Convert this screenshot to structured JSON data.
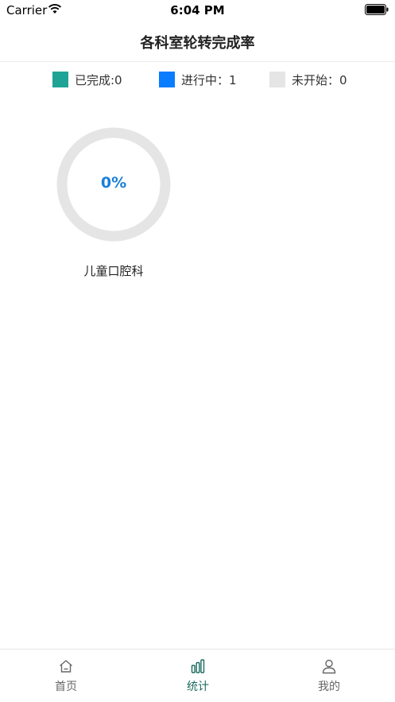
{
  "status_bar": {
    "carrier": "Carrier",
    "time": "6:04 PM"
  },
  "header": {
    "title": "各科室轮转完成率"
  },
  "legend": [
    {
      "label": "已完成:0",
      "color": "#1fa396"
    },
    {
      "label": "进行中：1",
      "color": "#0a7cff"
    },
    {
      "label": "未开始：0",
      "color": "#e5e5e5"
    }
  ],
  "departments": [
    {
      "name": "儿童口腔科",
      "percent_label": "0%",
      "completion": 0,
      "ring_color": "#e5e5e5",
      "progress_color": "#1a7fd8"
    }
  ],
  "tabs": [
    {
      "label": "首页",
      "icon": "home-icon",
      "active": false
    },
    {
      "label": "统计",
      "icon": "stats-icon",
      "active": true
    },
    {
      "label": "我的",
      "icon": "user-icon",
      "active": false
    }
  ],
  "colors": {
    "active_tab": "#1b6b5e",
    "inactive_tab": "#666666",
    "accent_text": "#1a7fd8"
  }
}
